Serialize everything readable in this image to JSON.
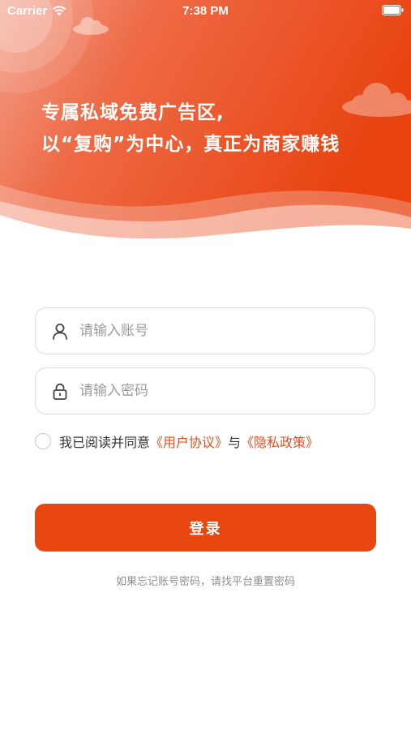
{
  "status_bar": {
    "carrier": "Carrier",
    "time": "7:38 PM"
  },
  "header": {
    "slogan_line1": "专属私域免费广告区,",
    "slogan_line2": "以“复购”为中心，真正为商家赚钱",
    "gradient_start": "#f5a891",
    "gradient_end": "#e8420f"
  },
  "form": {
    "account_placeholder": "请输入账号",
    "password_placeholder": "请输入密码",
    "account_icon": "user-icon",
    "password_icon": "lock-icon"
  },
  "agreement": {
    "prefix": "我已阅读并同意",
    "user_agreement": "《用户协议》",
    "conjunction": "与",
    "privacy_policy": "《隐私政策》",
    "checked": false,
    "link_color": "#e4501f"
  },
  "login_button": {
    "label": "登录",
    "color": "#e8470f"
  },
  "hint": "如果忘记账号密码，请找平台重置密码"
}
